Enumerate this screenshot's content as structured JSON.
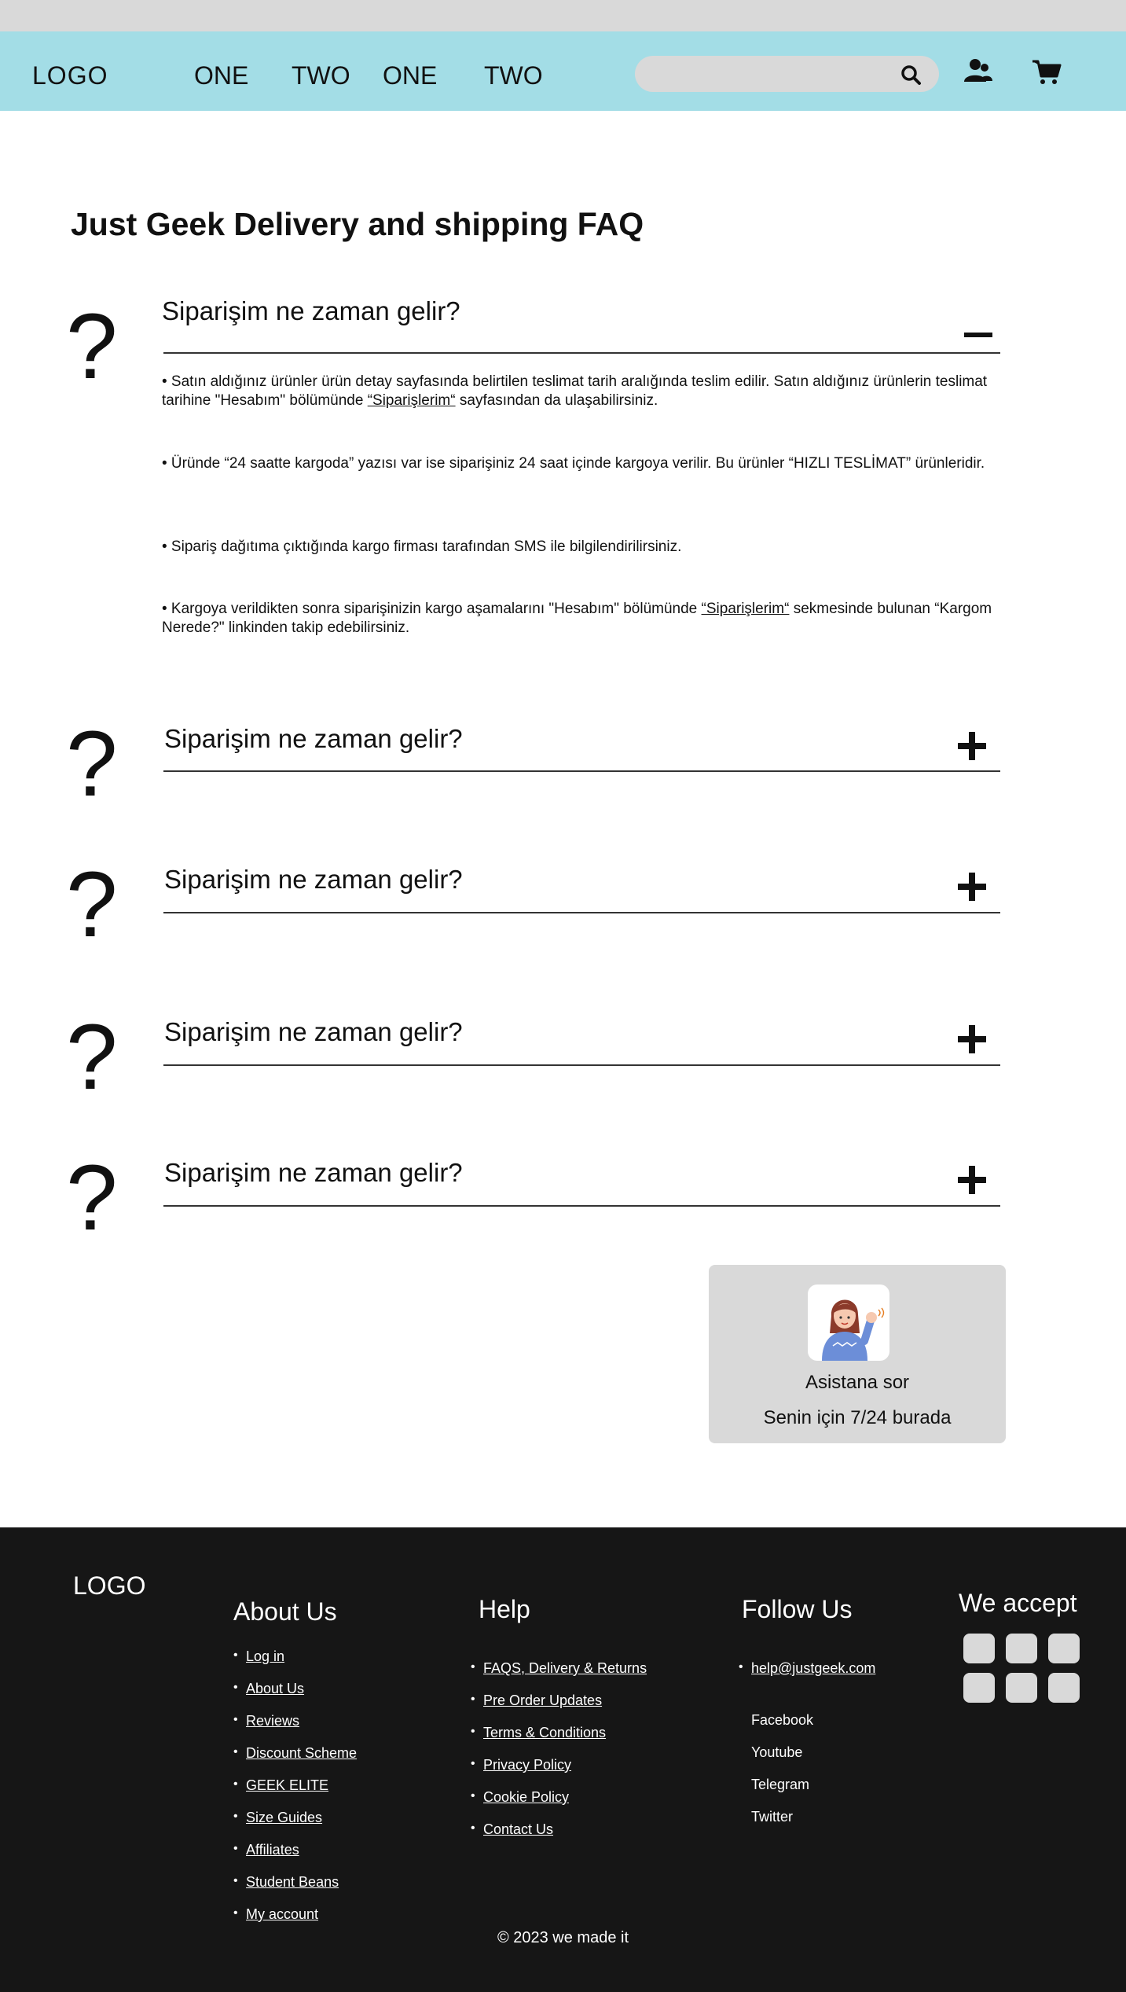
{
  "header": {
    "logo": "LOGO",
    "nav": [
      "ONE",
      "TWO",
      "ONE",
      "TWO"
    ],
    "search_placeholder": "",
    "icons": [
      "search-icon",
      "user-icon",
      "cart-icon"
    ],
    "bg_color": "#a3dde6"
  },
  "main": {
    "title": "Just Geek Delivery and shipping FAQ",
    "faq": [
      {
        "question": "Siparişim ne zaman gelir?",
        "state": "expanded",
        "toggle": "−"
      },
      {
        "question": "Siparişim ne zaman gelir?",
        "state": "collapsed",
        "toggle": "+"
      },
      {
        "question": "Siparişim ne zaman gelir?",
        "state": "collapsed",
        "toggle": "+"
      },
      {
        "question": "Siparişim ne zaman gelir?",
        "state": "collapsed",
        "toggle": "+"
      },
      {
        "question": "Siparişim ne zaman gelir?",
        "state": "collapsed",
        "toggle": "+"
      }
    ],
    "answer": {
      "p1_a": "• Satın aldığınız ürünler ürün detay sayfasında belirtilen teslimat tarih aralığında teslim edilir. Satın aldığınız ürünlerin teslimat tarihine \"Hesabım\" bölümünde ",
      "p1_link": "“Siparişlerim“",
      "p1_b": " sayfasından da ulaşabilirsiniz.",
      "p2": "• Üründe “24 saatte kargoda” yazısı var ise siparişiniz 24 saat içinde kargoya verilir. Bu ürünler “HIZLI TESLİMAT” ürünleridir.",
      "p3": "• Sipariş dağıtıma çıktığında kargo firması tarafından SMS ile bilgilendirilirsiniz.",
      "p4_a": "• Kargoya verildikten sonra siparişinizin kargo aşamalarını \"Hesabım\" bölümünde ",
      "p4_link": "“Siparişlerim“",
      "p4_b": " sekmesinde bulunan “Kargom Nerede?\" linkinden takip edebilirsiniz."
    },
    "assistant": {
      "title": "Asistana sor",
      "subtitle": "Senin için 7/24 burada"
    }
  },
  "footer": {
    "logo": "LOGO",
    "about": {
      "heading": "About Us",
      "links": [
        "Log in",
        "About Us",
        "Reviews",
        "Discount Scheme",
        "GEEK ELITE",
        "Size Guides",
        "Affiliates",
        "Student Beans",
        "My account"
      ]
    },
    "help": {
      "heading": "Help",
      "links": [
        "FAQS, Delivery & Returns",
        "Pre Order Updates",
        "Terms & Conditions",
        "Privacy Policy",
        "Cookie Policy",
        "Contact Us"
      ]
    },
    "follow": {
      "heading": "Follow Us",
      "email": "help@justgeek.com",
      "socials": [
        "Facebook",
        "Youtube",
        "Telegram",
        "Twitter"
      ]
    },
    "accept": {
      "heading": "We accept"
    },
    "copyright": "© 2023 we made it",
    "bg_color": "#161616"
  }
}
